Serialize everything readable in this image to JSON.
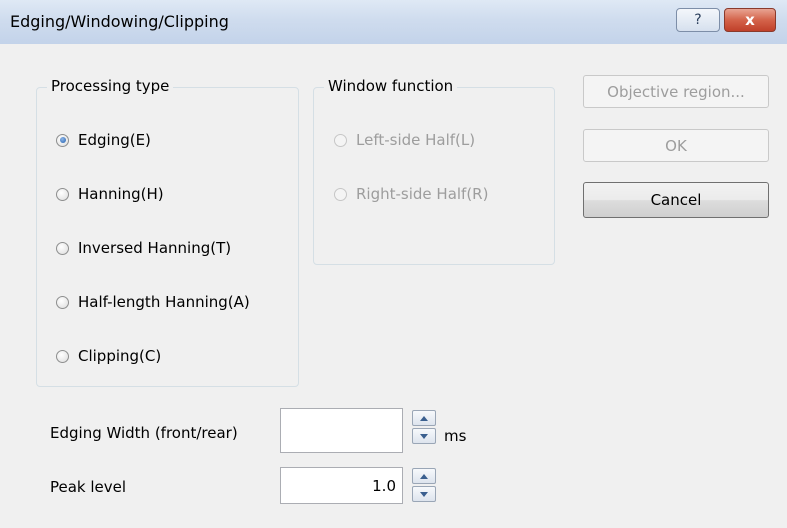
{
  "window": {
    "title": "Edging/Windowing/Clipping",
    "help_label": "?",
    "close_label": "x"
  },
  "processing_type": {
    "legend": "Processing type",
    "options": [
      {
        "label": "Edging(E)",
        "checked": true
      },
      {
        "label": "Hanning(H)",
        "checked": false
      },
      {
        "label": "Inversed Hanning(T)",
        "checked": false
      },
      {
        "label": "Half-length Hanning(A)",
        "checked": false
      },
      {
        "label": "Clipping(C)",
        "checked": false
      }
    ]
  },
  "window_function": {
    "legend": "Window function",
    "options": [
      {
        "label": "Left-side Half(L)",
        "enabled": false
      },
      {
        "label": "Right-side Half(R)",
        "enabled": false
      }
    ]
  },
  "buttons": {
    "objective_region": "Objective region...",
    "ok": "OK",
    "cancel": "Cancel"
  },
  "edging_width": {
    "label": "Edging Width (front/rear)",
    "value": "",
    "unit": "ms"
  },
  "peak_level": {
    "label": "Peak level",
    "value": "1.0"
  }
}
